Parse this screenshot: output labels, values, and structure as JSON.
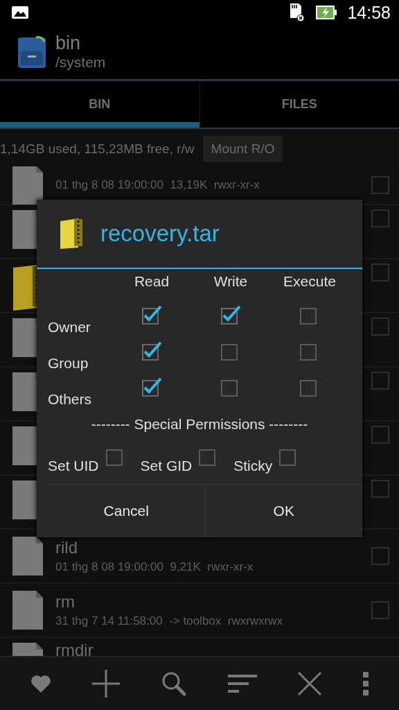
{
  "status_bar": {
    "time": "14:58"
  },
  "action_bar": {
    "title": "bin",
    "subtitle": "/system"
  },
  "tabs": [
    {
      "label": "BIN",
      "selected": true
    },
    {
      "label": "FILES",
      "selected": false
    }
  ],
  "storage": {
    "text": "1,14GB used, 115,23MB free, r/w",
    "button": "Mount R/O"
  },
  "files": [
    {
      "kind": "file",
      "details": "01 thg 8 08 19:00:00  13,19K  rwxr-xr-x",
      "checked": false
    },
    {
      "kind": "file",
      "checked": false
    },
    {
      "kind": "folder",
      "checked": false
    },
    {
      "kind": "file",
      "checked": false
    },
    {
      "kind": "file",
      "checked": false
    },
    {
      "kind": "file",
      "checked": false
    },
    {
      "kind": "file",
      "checked": false
    },
    {
      "kind": "file",
      "name": "rild",
      "details": "01 thg 8 08 19:00:00  9,21K  rwxr-xr-x",
      "checked": false
    },
    {
      "kind": "file",
      "name": "rm",
      "details": "31 thg 7 14 11:58:00  -> toolbox  rwxrwxrwx",
      "checked": false
    },
    {
      "kind": "file",
      "name": "rmdir"
    }
  ],
  "dialog": {
    "title": "recovery.tar",
    "columns": [
      "Read",
      "Write",
      "Execute"
    ],
    "rows": [
      {
        "label": "Owner",
        "permissions": [
          {
            "checked": true
          },
          {
            "checked": true
          },
          {
            "checked": false
          }
        ]
      },
      {
        "label": "Group",
        "permissions": [
          {
            "checked": true
          },
          {
            "checked": false
          },
          {
            "checked": false
          }
        ]
      },
      {
        "label": "Others",
        "permissions": [
          {
            "checked": true
          },
          {
            "checked": false
          },
          {
            "checked": false
          }
        ]
      }
    ],
    "special_heading": "-------- Special Permissions --------",
    "special": [
      {
        "label": "Set UID",
        "checked": false
      },
      {
        "label": "Set GID",
        "checked": false
      },
      {
        "label": "Sticky",
        "checked": false
      }
    ],
    "buttons": [
      "Cancel",
      "OK"
    ]
  }
}
